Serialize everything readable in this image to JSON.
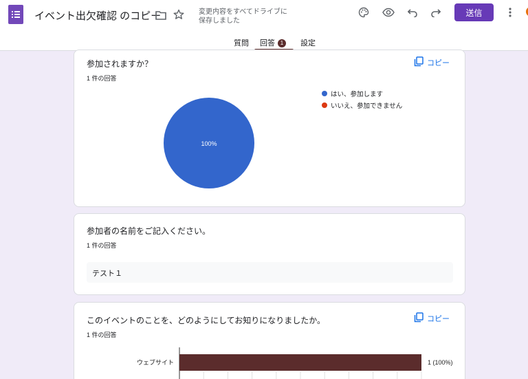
{
  "header": {
    "title": "イベント出欠確認 のコピー",
    "save_status": "変更内容をすべてドライブに保存しました",
    "send_label": "送信"
  },
  "tabs": [
    {
      "label": "質問"
    },
    {
      "label": "回答",
      "badge": "1"
    },
    {
      "label": "設定"
    }
  ],
  "cards": [
    {
      "title": "参加されますか？",
      "count": "1 件の回答",
      "copy_label": "コピー",
      "chart_data": {
        "type": "pie",
        "slices": [
          {
            "label": "はい、参加します",
            "value": 100,
            "color": "#3366cc"
          },
          {
            "label": "いいえ、参加できません",
            "value": 0,
            "color": "#dc3912"
          }
        ],
        "center_label": "100%"
      }
    },
    {
      "title": "参加者の名前をご記入ください。",
      "count": "1 件の回答",
      "answer": "テスト１"
    },
    {
      "title": "このイベントのことを、どのようにしてお知りになりましたか。",
      "count": "1 件の回答",
      "copy_label": "コピー",
      "chart_data": {
        "type": "bar",
        "categories": [
          "ウェブサイト"
        ],
        "values": [
          1
        ],
        "data_labels": [
          "1 (100%)"
        ],
        "color": "#5b2c2c"
      }
    }
  ],
  "colors": {
    "brand": "#673ab7",
    "accent": "#5b2c2c",
    "link": "#1a73e8",
    "background": "#f0ebf8"
  },
  "icons": [
    "forms-icon",
    "folder-icon",
    "star-icon",
    "palette-icon",
    "preview-icon",
    "undo-icon",
    "redo-icon",
    "more-icon",
    "copy-icon"
  ]
}
